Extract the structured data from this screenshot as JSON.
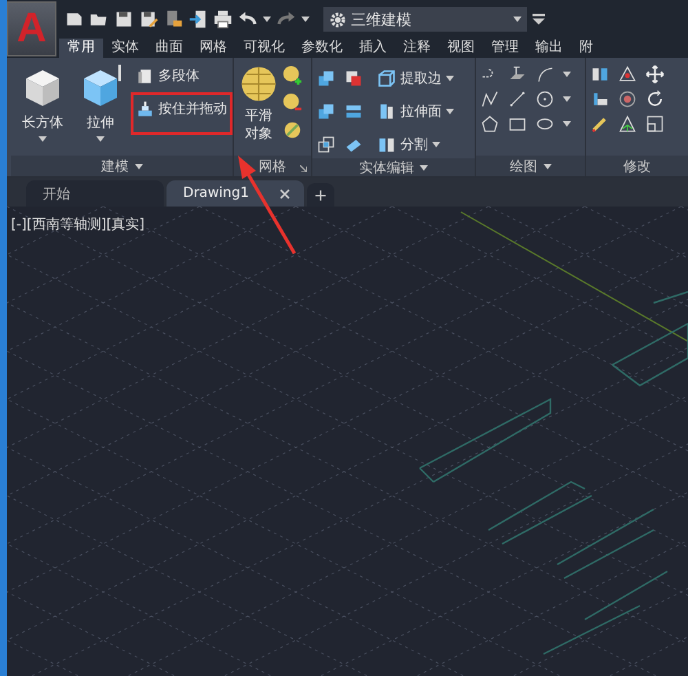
{
  "logo": {
    "letter": "A"
  },
  "workspace": {
    "label": "三维建模"
  },
  "ribbon_tabs": [
    {
      "label": "常用",
      "selected": true
    },
    {
      "label": "实体",
      "selected": false
    },
    {
      "label": "曲面",
      "selected": false
    },
    {
      "label": "网格",
      "selected": false
    },
    {
      "label": "可视化",
      "selected": false
    },
    {
      "label": "参数化",
      "selected": false
    },
    {
      "label": "插入",
      "selected": false
    },
    {
      "label": "注释",
      "selected": false
    },
    {
      "label": "视图",
      "selected": false
    },
    {
      "label": "管理",
      "selected": false
    },
    {
      "label": "输出",
      "selected": false
    },
    {
      "label": "附",
      "selected": false
    }
  ],
  "panels": [
    {
      "title": "建模",
      "title_menu": true,
      "large_buttons": [
        {
          "label": "长方体",
          "menu": true
        },
        {
          "label": "拉伸",
          "menu": true
        }
      ],
      "small_buttons": [
        {
          "label": "多段体",
          "highlighted": false
        },
        {
          "label": "按住并拖动",
          "highlighted": true
        }
      ]
    },
    {
      "title": "网格",
      "launcher": true,
      "large_buttons": [
        {
          "label": "平滑对象",
          "menu": false
        }
      ]
    },
    {
      "title": "实体编辑",
      "title_menu": true,
      "small_buttons": [
        {
          "label": "提取边",
          "menu": true
        },
        {
          "label": "拉伸面",
          "menu": true
        },
        {
          "label": "分割",
          "menu": true
        }
      ]
    },
    {
      "title": "绘图",
      "title_menu": true
    },
    {
      "title": "修改"
    }
  ],
  "document_tabs": [
    {
      "label": "开始",
      "selected": false,
      "closable": false
    },
    {
      "label": "Drawing1",
      "selected": true,
      "closable": true
    }
  ],
  "viewport": {
    "label": "[-][西南等轴测][真实]"
  }
}
